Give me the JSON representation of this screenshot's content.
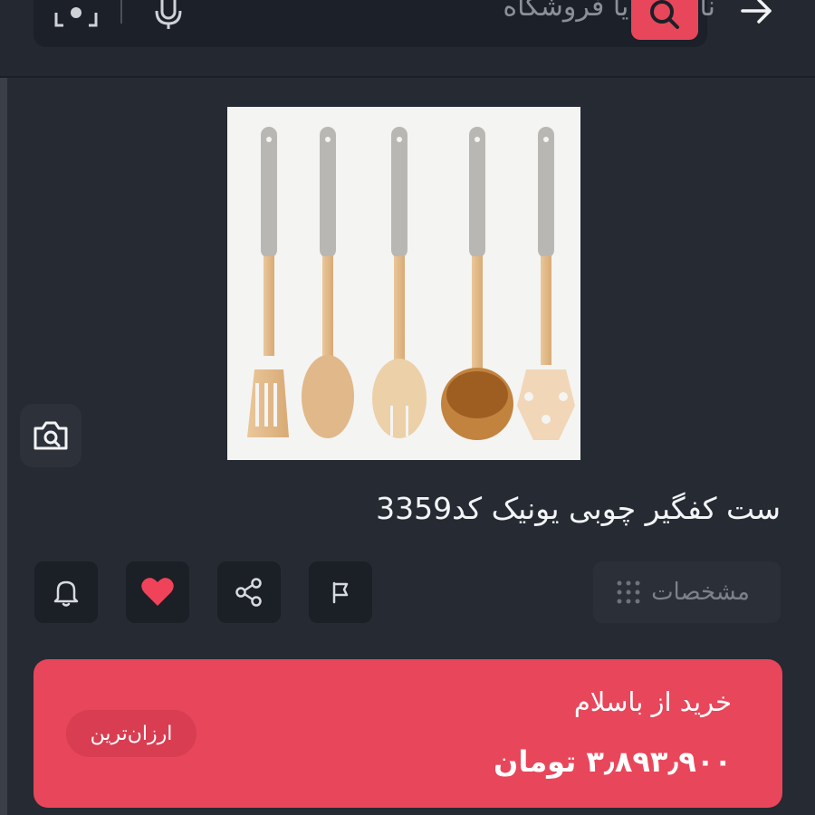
{
  "search": {
    "placeholder": "نام کالا یا فروشگاه"
  },
  "icons": {
    "back": "arrow-right-icon",
    "search": "search-icon",
    "mic": "microphone-icon",
    "camera_scan": "camera-scan-icon",
    "image_search": "camera-search-icon",
    "notify": "bell-icon",
    "favorite": "heart-icon",
    "share": "share-icon",
    "report": "flag-icon",
    "specs": "grid-dots-icon"
  },
  "product": {
    "title": "ست کفگیر چوبی یونیک کد3359"
  },
  "actions": {
    "specs_label": "مشخصات"
  },
  "buy": {
    "title": "خرید از باسلام",
    "price": "۳٫۸۹۳٫۹۰۰ تومان",
    "badge": "ارزان‌ترین"
  },
  "colors": {
    "background": "#252a33",
    "accent": "#e8465a",
    "heart": "#f0435a"
  }
}
